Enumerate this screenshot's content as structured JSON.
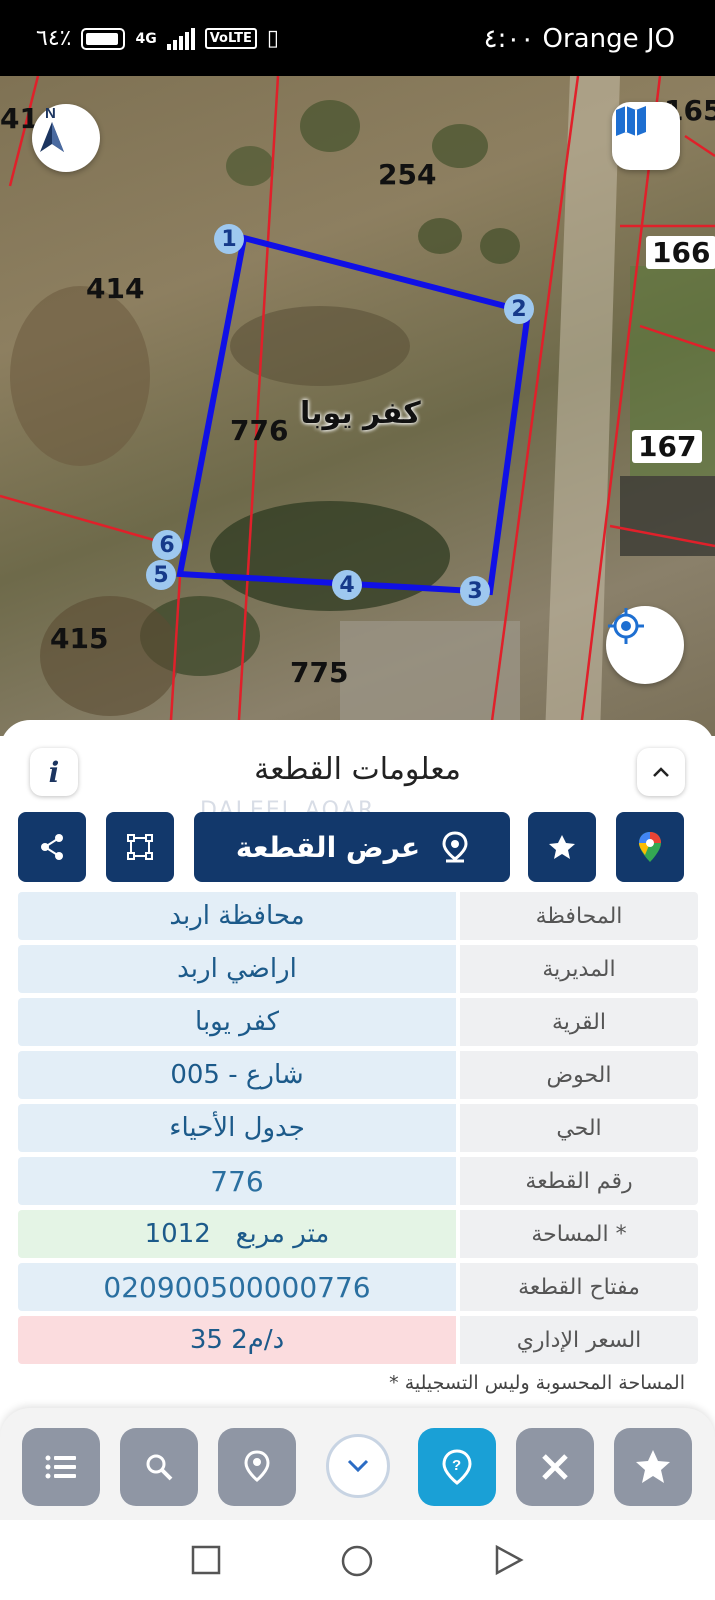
{
  "status_bar": {
    "battery": "٦٤٪",
    "network": "4G",
    "volte": "VoLTE",
    "time_carrier": "٤:٠٠ Orange JO"
  },
  "map": {
    "village_name": "كفر يوبا",
    "plot_labels": [
      "254",
      "414",
      "776",
      "415",
      "775",
      "166",
      "167",
      "165",
      "41"
    ],
    "vertices": [
      "1",
      "2",
      "3",
      "4",
      "5",
      "6"
    ],
    "icons": {
      "north": "north-arrow-icon",
      "layers": "map-layers-icon",
      "locate": "my-location-icon"
    },
    "colors": {
      "parcel_outline": "#1010e6",
      "boundary_lines": "#e0202a"
    }
  },
  "sheet": {
    "title": "معلومات القطعة",
    "info_glyph": "i",
    "watermark": "DALEEL AQAR",
    "actions": {
      "view_plot": "عرض القطعة"
    },
    "rows": [
      {
        "key": "المحافظة",
        "value": "محافظة اربد"
      },
      {
        "key": "المديرية",
        "value": "اراضي اربد"
      },
      {
        "key": "القرية",
        "value": "كفر يوبا"
      },
      {
        "key": "الحوض",
        "value": "شارع - 005"
      },
      {
        "key": "الحي",
        "value": "جدول الأحياء"
      },
      {
        "key": "رقم القطعة",
        "value": "776"
      },
      {
        "key": "المساحة *",
        "value": "1012   متر مربع"
      },
      {
        "key": "مفتاح القطعة",
        "value": "020900500000776"
      },
      {
        "key": "السعر الإداري",
        "value": "35 د/م2"
      }
    ],
    "note": "* المساحة المحسوبة وليس التسجيلية",
    "colors": {
      "action_bg": "#12386b",
      "value_blue": "#1c5a8a",
      "area_green": "#e4f4e5",
      "price_red": "#fbdcde"
    }
  },
  "bottom_nav": {
    "items": [
      "list-icon",
      "search-icon",
      "location-pin-icon",
      "chevron-down-icon",
      "help-icon",
      "tools-icon",
      "star-icon"
    ],
    "active": "help-icon",
    "accent": "#1aa0d6"
  },
  "system_nav": [
    "recent-apps-icon",
    "home-icon",
    "back-icon"
  ]
}
